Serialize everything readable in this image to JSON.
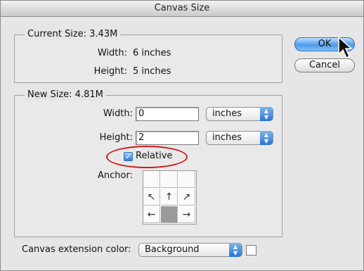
{
  "window": {
    "title": "Canvas Size"
  },
  "current_size": {
    "legend": "Current Size: 3.43M",
    "width_label": "Width:",
    "width_value": "6 inches",
    "height_label": "Height:",
    "height_value": "5 inches"
  },
  "new_size": {
    "legend": "New Size: 4.81M",
    "width_label": "Width:",
    "width_value": "0",
    "width_unit": "inches",
    "height_label": "Height:",
    "height_value": "2",
    "height_unit": "inches",
    "relative_label": "Relative",
    "relative_checked": true,
    "anchor_label": "Anchor:"
  },
  "anchor_grid": {
    "cells": [
      "",
      "",
      "",
      "↖",
      "↑",
      "↗",
      "←",
      "",
      "→"
    ]
  },
  "buttons": {
    "ok": "OK",
    "cancel": "Cancel"
  },
  "extension": {
    "label": "Canvas extension color:",
    "value": "Background",
    "swatch_color": "#ffffff"
  },
  "icons": {
    "select_arrows": "updown-arrows-icon",
    "pointer": "mouse-pointer-icon",
    "check": "checkmark-icon"
  }
}
